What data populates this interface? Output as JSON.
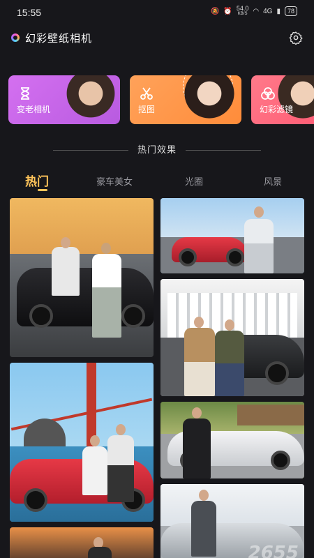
{
  "status_bar": {
    "time": "15:55",
    "net_speed": "54.0",
    "net_unit": "KB/S",
    "signal": "4G",
    "battery": "78"
  },
  "header": {
    "title": "幻彩壁纸相机",
    "settings_icon": "gear-icon"
  },
  "feature_cards": [
    {
      "label": "变老相机",
      "icon": "hourglass-icon",
      "color": "#c863ea"
    },
    {
      "label": "抠图",
      "icon": "scissors-icon",
      "color": "#ff9a4a"
    },
    {
      "label": "幻彩滤镜",
      "icon": "filter-icon",
      "color": "#ff6a80"
    }
  ],
  "section": {
    "title": "热门效果"
  },
  "tabs": [
    {
      "label": "热门",
      "active": true
    },
    {
      "label": "豪车美女",
      "active": false
    },
    {
      "label": "光圈",
      "active": false
    },
    {
      "label": "风景",
      "active": false
    }
  ],
  "accent_color": "#ffc45a",
  "watermark": "2655"
}
